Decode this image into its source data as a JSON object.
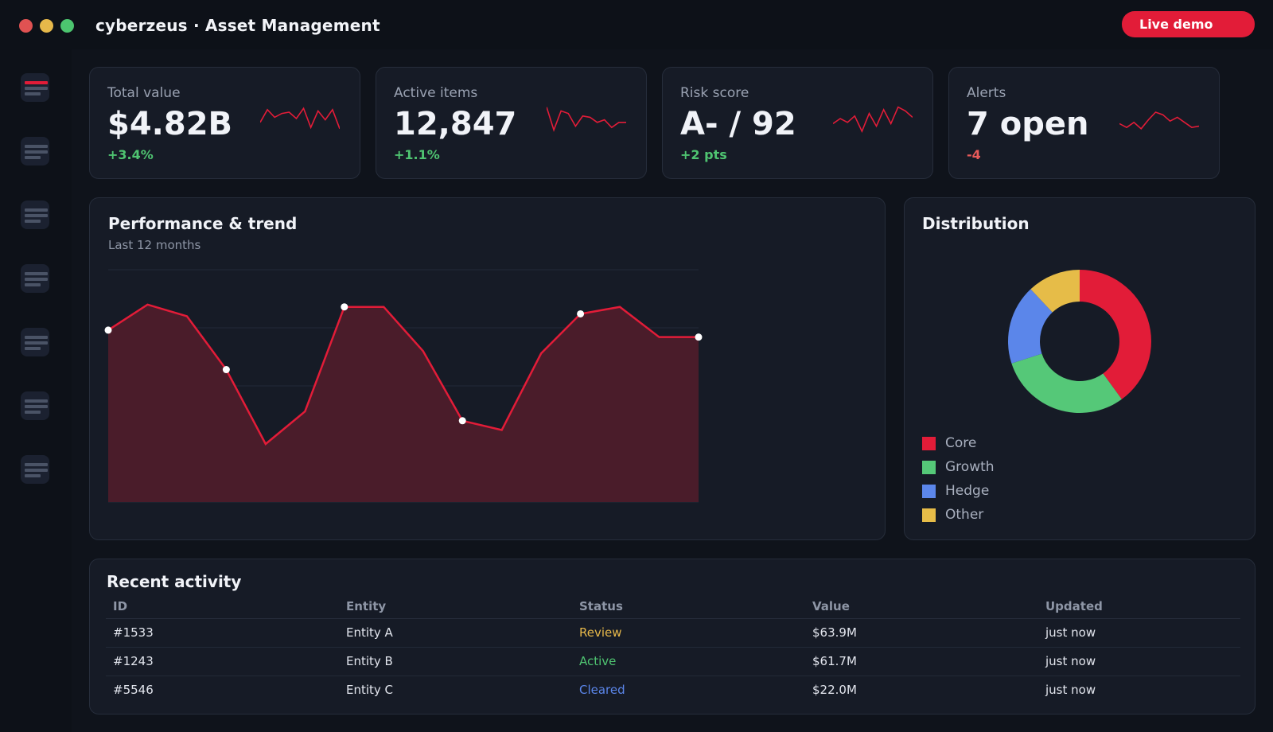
{
  "window": {
    "title": "cyberzeus · Asset Management",
    "live_button": "Live demo"
  },
  "sidebar": {
    "items": [
      "menu-1",
      "menu-2",
      "menu-3",
      "menu-4",
      "menu-5",
      "menu-6",
      "menu-7"
    ]
  },
  "kpis": [
    {
      "label": "Total value",
      "value": "$4.82B",
      "delta": "+3.4%",
      "trend": "up",
      "spark": [
        0.35,
        0.85,
        0.55,
        0.7,
        0.75,
        0.5,
        0.9,
        0.15,
        0.8,
        0.45,
        0.85,
        0.1
      ]
    },
    {
      "label": "Active items",
      "value": "12,847",
      "delta": "+1.1%",
      "trend": "up",
      "spark": [
        0.95,
        0.05,
        0.8,
        0.7,
        0.2,
        0.6,
        0.55,
        0.35,
        0.45,
        0.15,
        0.35,
        0.35
      ]
    },
    {
      "label": "Risk score",
      "value": "A- / 92",
      "delta": "+2 pts",
      "trend": "up",
      "spark": [
        0.3,
        0.5,
        0.35,
        0.6,
        0.0,
        0.7,
        0.2,
        0.85,
        0.3,
        0.95,
        0.8,
        0.55
      ]
    },
    {
      "label": "Alerts",
      "value": "7 open",
      "delta": "-4",
      "trend": "down",
      "spark": [
        0.3,
        0.15,
        0.35,
        0.1,
        0.45,
        0.75,
        0.65,
        0.4,
        0.55,
        0.35,
        0.15,
        0.2
      ]
    }
  ],
  "performance": {
    "title": "Performance & trend",
    "subtitle": "Last 12 months"
  },
  "distribution": {
    "title": "Distribution"
  },
  "chart_data": [
    {
      "type": "area",
      "title": "Performance & trend",
      "subtitle": "Last 12 months",
      "x": [
        1,
        2,
        3,
        4,
        5,
        6,
        7,
        8,
        9,
        10,
        11,
        12,
        13,
        14,
        15,
        16
      ],
      "values": [
        74,
        85,
        80,
        57,
        25,
        39,
        84,
        84,
        65,
        35,
        31,
        64,
        81,
        84,
        71,
        71
      ],
      "ylim": [
        0,
        100
      ],
      "marked_points": [
        0,
        3,
        6,
        9,
        12,
        15
      ],
      "color": "#e21c38",
      "grid": true
    },
    {
      "type": "pie",
      "title": "Distribution",
      "labels": [
        "Core",
        "Growth",
        "Hedge",
        "Other"
      ],
      "values": [
        40,
        30,
        18,
        12
      ],
      "colors": [
        "#e21c38",
        "#55c878",
        "#5b86ea",
        "#e6bc48"
      ],
      "legend": "bottom-left"
    }
  ],
  "activity": {
    "title": "Recent activity",
    "columns": [
      "ID",
      "Entity",
      "Status",
      "Value",
      "Updated"
    ],
    "rows": [
      {
        "id": "#1533",
        "entity": "Entity A",
        "status": "Review",
        "status_color": "#e6b84a",
        "value": "$63.9M",
        "updated": "just now"
      },
      {
        "id": "#1243",
        "entity": "Entity B",
        "status": "Active",
        "status_color": "#4fc471",
        "value": "$61.7M",
        "updated": "just now"
      },
      {
        "id": "#5546",
        "entity": "Entity C",
        "status": "Cleared",
        "status_color": "#5b86ea",
        "value": "$22.0M",
        "updated": "just now"
      }
    ]
  }
}
